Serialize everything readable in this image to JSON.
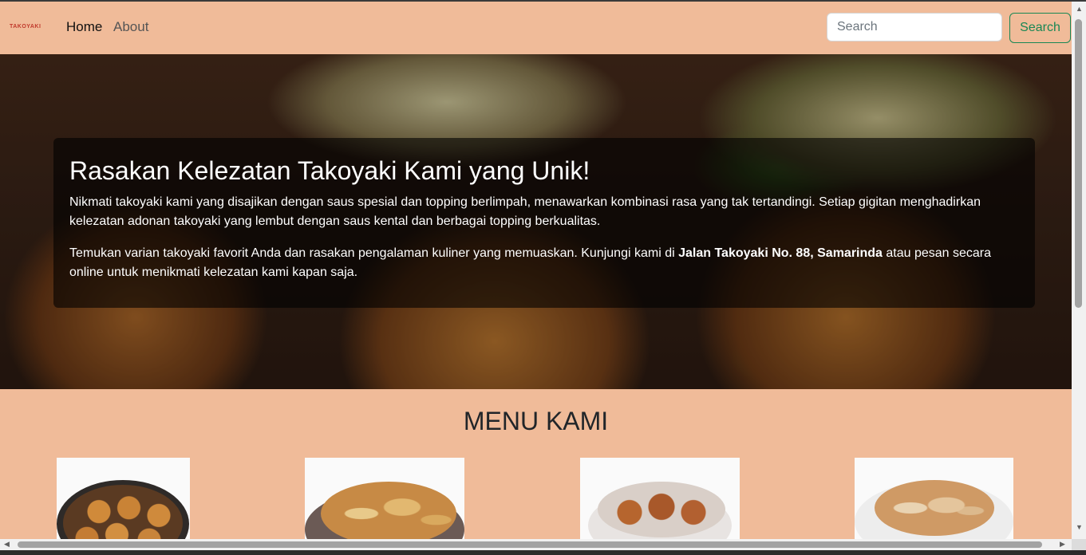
{
  "navbar": {
    "logo_text": "TAKOYAKI",
    "links": [
      "Home",
      "About"
    ],
    "search_placeholder": "Search",
    "search_button": "Search"
  },
  "hero": {
    "title": "Rasakan Kelezatan Takoyaki Kami yang Unik!",
    "paragraph1": "Nikmati takoyaki kami yang disajikan dengan saus spesial dan topping berlimpah, menawarkan kombinasi rasa yang tak tertandingi. Setiap gigitan menghadirkan kelezatan adonan takoyaki yang lembut dengan saus kental dan berbagai topping berkualitas.",
    "paragraph2_before": "Temukan varian takoyaki favorit Anda dan rasakan pengalaman kuliner yang memuaskan. Kunjungi kami di ",
    "paragraph2_bold": "Jalan Takoyaki No. 88, Samarinda",
    "paragraph2_after": " atau pesan secara online untuk menikmati kelezatan kami kapan saja."
  },
  "menu": {
    "title": "MENU KAMI"
  },
  "colors": {
    "page_bg": "#f0bb99",
    "search_button": "#198754"
  }
}
